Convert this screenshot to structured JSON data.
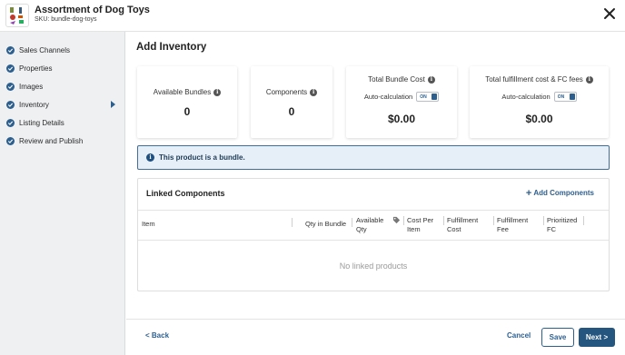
{
  "header": {
    "title": "Assortment of Dog Toys",
    "sku": "SKU: bundle-dog-toys",
    "logo_icon": "product-thumbnail",
    "close_icon": "close-icon"
  },
  "sidebar": {
    "items": [
      {
        "label": "Sales Channels",
        "completed": true,
        "active": false
      },
      {
        "label": "Properties",
        "completed": true,
        "active": false
      },
      {
        "label": "Images",
        "completed": true,
        "active": false
      },
      {
        "label": "Inventory",
        "completed": true,
        "active": true
      },
      {
        "label": "Listing Details",
        "completed": true,
        "active": false
      },
      {
        "label": "Review and Publish",
        "completed": true,
        "active": false
      }
    ]
  },
  "main": {
    "title": "Add Inventory",
    "cards": {
      "available_bundles": {
        "label": "Available Bundles",
        "value": "0"
      },
      "components": {
        "label": "Components",
        "value": "0"
      },
      "total_bundle_cost": {
        "label": "Total Bundle Cost",
        "auto_label": "Auto-calculation",
        "toggle": "ON",
        "value": "$0.00"
      },
      "fulfillment_cost": {
        "label": "Total fulfillment cost & FC fees",
        "auto_label": "Auto-calculation",
        "toggle": "ON",
        "value": "$0.00"
      }
    },
    "banner": "This product is a bundle.",
    "linked": {
      "title": "Linked Components",
      "add_button": "Add Components",
      "columns": {
        "item": "Item",
        "qty_in_bundle": "Qty in Bundle",
        "available_qty_1": "Available",
        "available_qty_2": "Qty",
        "cost_per_item_1": "Cost Per",
        "cost_per_item_2": "Item",
        "fulfillment_cost_1": "Fulfillment",
        "fulfillment_cost_2": "Cost",
        "fulfillment_fee_1": "Fulfillment",
        "fulfillment_fee_2": "Fee",
        "prioritized_fc_1": "Prioritized",
        "prioritized_fc_2": "FC"
      },
      "empty_text": "No linked products"
    }
  },
  "footer": {
    "back": "< Back",
    "cancel": "Cancel",
    "save": "Save",
    "next": "Next >"
  },
  "colors": {
    "accent": "#2d5f8e",
    "sidebar_bg": "#eef0f2",
    "banner_bg": "#e6eff7",
    "next_bg": "#24567f"
  }
}
